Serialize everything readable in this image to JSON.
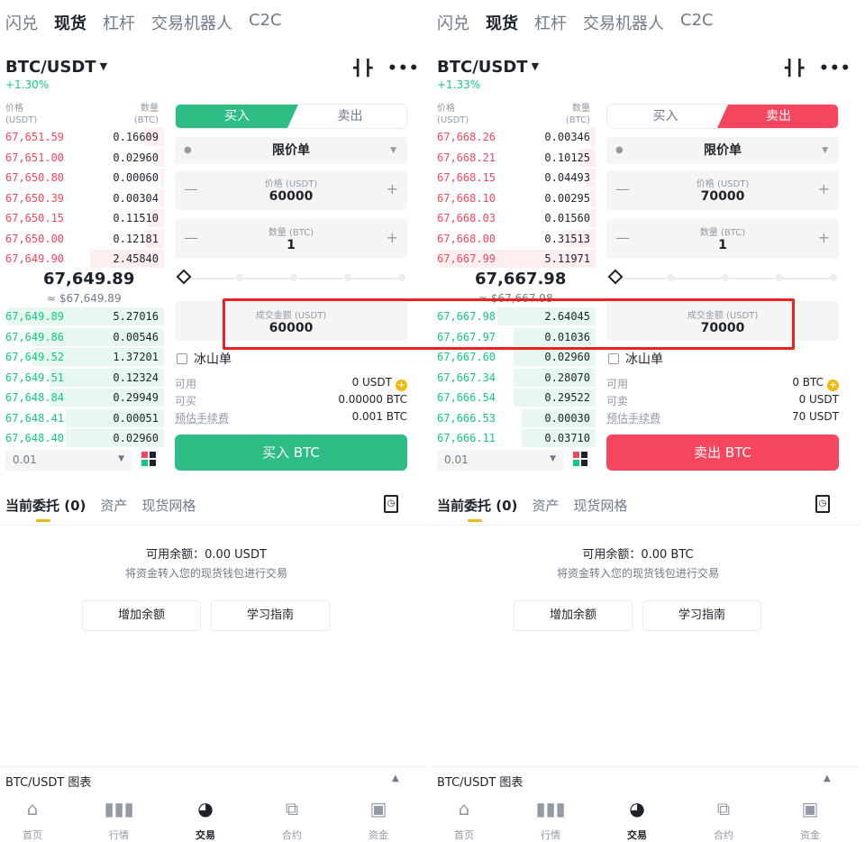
{
  "panels": [
    {
      "top_tabs": [
        "闪兑",
        "现货",
        "杠杆",
        "交易机器人",
        "C2C"
      ],
      "active_top_tab": "现货",
      "pair": "BTC/USDT",
      "change": "+1.30%",
      "ob_price_header": "价格\n(USDT)",
      "ob_qty_header": "数量\n(BTC)",
      "asks": [
        {
          "price": "67,651.59",
          "qty": "0.16609",
          "depth": 0.12
        },
        {
          "price": "67,651.00",
          "qty": "0.02960",
          "depth": 0.05
        },
        {
          "price": "67,650.80",
          "qty": "0.00060",
          "depth": 0.02
        },
        {
          "price": "67,650.39",
          "qty": "0.00304",
          "depth": 0.03
        },
        {
          "price": "67,650.15",
          "qty": "0.11510",
          "depth": 0.1
        },
        {
          "price": "67,650.00",
          "qty": "0.12181",
          "depth": 0.11
        },
        {
          "price": "67,649.90",
          "qty": "2.45840",
          "depth": 0.45
        }
      ],
      "mid_price": "67,649.89",
      "mid_fiat": "≈ $67,649.89",
      "bids": [
        {
          "price": "67,649.89",
          "qty": "5.27016",
          "depth": 0.95
        },
        {
          "price": "67,649.86",
          "qty": "0.00546",
          "depth": 0.8
        },
        {
          "price": "67,649.52",
          "qty": "1.37201",
          "depth": 0.8
        },
        {
          "price": "67,649.51",
          "qty": "0.12324",
          "depth": 0.7
        },
        {
          "price": "67,648.84",
          "qty": "0.29949",
          "depth": 0.7
        },
        {
          "price": "67,648.41",
          "qty": "0.00051",
          "depth": 0.6
        },
        {
          "price": "67,648.40",
          "qty": "0.02960",
          "depth": 0.6
        }
      ],
      "depth_value": "0.01",
      "side_buy": "买入",
      "side_sell": "卖出",
      "active_side": "buy",
      "order_type": "限价单",
      "price_label": "价格 (USDT)",
      "price_value": "60000",
      "amount_label": "数量 (BTC)",
      "amount_value": "1",
      "total_label": "成交金额 (USDT)",
      "total_value": "60000",
      "iceberg": "冰山单",
      "avail_label": "可用",
      "avail_value": "0 USDT",
      "can_label": "可买",
      "can_value": "0.00000 BTC",
      "fee_label": "预估手续费",
      "fee_value": "0.001 BTC",
      "action_label": "买入 BTC",
      "sub_tabs": [
        "当前委托 (0)",
        "资产",
        "现货网格"
      ],
      "empty_balance": "可用余额：0.00 USDT",
      "empty_hint": "将资金转入您的现货钱包进行交易",
      "btn_add": "增加余额",
      "btn_learn": "学习指南",
      "chart_label": "BTC/USDT 图表",
      "nav": [
        "首页",
        "行情",
        "交易",
        "合约",
        "资金"
      ],
      "active_nav": "交易"
    },
    {
      "top_tabs": [
        "闪兑",
        "现货",
        "杠杆",
        "交易机器人",
        "C2C"
      ],
      "active_top_tab": "现货",
      "pair": "BTC/USDT",
      "change": "+1.33%",
      "ob_price_header": "价格\n(USDT)",
      "ob_qty_header": "数量\n(BTC)",
      "asks": [
        {
          "price": "67,668.26",
          "qty": "0.00346",
          "depth": 0.03
        },
        {
          "price": "67,668.21",
          "qty": "0.10125",
          "depth": 0.1
        },
        {
          "price": "67,668.15",
          "qty": "0.04493",
          "depth": 0.06
        },
        {
          "price": "67,668.10",
          "qty": "0.00295",
          "depth": 0.03
        },
        {
          "price": "67,668.03",
          "qty": "0.01560",
          "depth": 0.04
        },
        {
          "price": "67,668.00",
          "qty": "0.31513",
          "depth": 0.2
        },
        {
          "price": "67,667.99",
          "qty": "5.11971",
          "depth": 0.95
        }
      ],
      "mid_price": "67,667.98",
      "mid_fiat": "≈ $67,667.98",
      "bids": [
        {
          "price": "67,667.98",
          "qty": "2.64045",
          "depth": 0.6
        },
        {
          "price": "67,667.97",
          "qty": "0.01036",
          "depth": 0.5
        },
        {
          "price": "67,667.60",
          "qty": "0.02960",
          "depth": 0.5
        },
        {
          "price": "67,667.34",
          "qty": "0.28070",
          "depth": 0.5
        },
        {
          "price": "67,666.54",
          "qty": "0.29522",
          "depth": 0.5
        },
        {
          "price": "67,666.53",
          "qty": "0.00030",
          "depth": 0.45
        },
        {
          "price": "67,666.11",
          "qty": "0.03710",
          "depth": 0.45
        }
      ],
      "depth_value": "0.01",
      "side_buy": "买入",
      "side_sell": "卖出",
      "active_side": "sell",
      "order_type": "限价单",
      "price_label": "价格 (USDT)",
      "price_value": "70000",
      "amount_label": "数量 (BTC)",
      "amount_value": "1",
      "total_label": "成交金额 (USDT)",
      "total_value": "70000",
      "iceberg": "冰山单",
      "avail_label": "可用",
      "avail_value": "0 BTC",
      "can_label": "可卖",
      "can_value": "0 USDT",
      "fee_label": "预估手续费",
      "fee_value": "70 USDT",
      "action_label": "卖出 BTC",
      "sub_tabs": [
        "当前委托 (0)",
        "资产",
        "现货网格"
      ],
      "empty_balance": "可用余额：0.00 BTC",
      "empty_hint": "将资金转入您的现货钱包进行交易",
      "btn_add": "增加余额",
      "btn_learn": "学习指南",
      "chart_label": "BTC/USDT 图表",
      "nav": [
        "首页",
        "行情",
        "交易",
        "合约",
        "资金"
      ],
      "active_nav": "交易"
    }
  ],
  "icons": {
    "candle": "candlestick-icon",
    "more": "more-icon",
    "info": "info-icon",
    "nav": [
      "home-icon",
      "markets-icon",
      "trade-icon",
      "futures-icon",
      "wallet-icon"
    ]
  },
  "colors": {
    "buy": "#2ebd85",
    "sell": "#f6465d",
    "accent": "#f0b90b",
    "highlight": "#e8221c"
  }
}
